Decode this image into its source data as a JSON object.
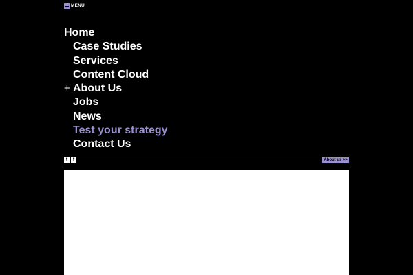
{
  "menu": {
    "label": "MENU",
    "icon": "hamburger-icon"
  },
  "nav": {
    "items": [
      {
        "label": "Home"
      },
      {
        "label": "Case Studies"
      },
      {
        "label": "Services"
      },
      {
        "label": "Content Cloud"
      },
      {
        "label": "About Us",
        "expander": "+"
      },
      {
        "label": "Jobs"
      },
      {
        "label": "News"
      },
      {
        "label": "Test your strategy",
        "color": "#9a8fd0"
      },
      {
        "label": "Contact Us"
      }
    ]
  },
  "social": {
    "twitter_glyph": "t",
    "facebook_glyph": "f"
  },
  "about_link": {
    "label": "About us >>"
  },
  "colors": {
    "background": "#000000",
    "text": "#ffffff",
    "accent": "#9a8fd0",
    "panel": "#ffffff"
  }
}
